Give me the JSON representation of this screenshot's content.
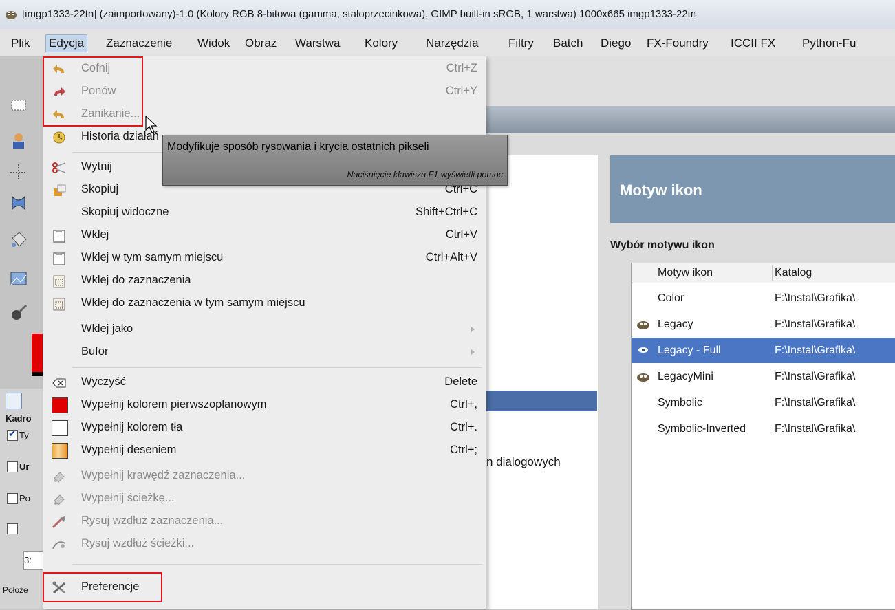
{
  "window": {
    "title": "[imgp1333-22tn] (zaimportowany)-1.0 (Kolory RGB 8-bitowa (gamma, stałoprzecinkowa), GIMP built-in sRGB, 1 warstwa) 1000x665 imgp1333-22tn"
  },
  "menubar": {
    "items": [
      "Plik",
      "Edycja",
      "Zaznaczenie",
      "Widok",
      "Obraz",
      "Warstwa",
      "Kolory",
      "Narzędzia",
      "Filtry",
      "Batch",
      "Diego",
      "FX-Foundry",
      "ICCII FX",
      "Python-Fu"
    ],
    "active": "Edycja"
  },
  "edit_menu": {
    "items": [
      {
        "label": "Cofnij",
        "shortcut": "Ctrl+Z",
        "icon": "undo-icon",
        "disabled": true
      },
      {
        "label": "Ponów",
        "shortcut": "Ctrl+Y",
        "icon": "redo-icon",
        "disabled": true
      },
      {
        "label": "Zanikanie...",
        "shortcut": "",
        "icon": "fade-icon",
        "disabled": true
      },
      {
        "label": "Historia działań",
        "shortcut": "",
        "icon": "history-icon",
        "disabled": false
      },
      {
        "label": "Wytnij",
        "shortcut": "",
        "icon": "cut-icon",
        "disabled": false
      },
      {
        "label": "Skopiuj",
        "shortcut": "Ctrl+C",
        "icon": "copy-icon",
        "disabled": false
      },
      {
        "label": "Skopiuj widoczne",
        "shortcut": "Shift+Ctrl+C",
        "icon": "",
        "disabled": false
      },
      {
        "label": "Wklej",
        "shortcut": "Ctrl+V",
        "icon": "paste-icon",
        "disabled": false
      },
      {
        "label": "Wklej w tym samym miejscu",
        "shortcut": "Ctrl+Alt+V",
        "icon": "paste-in-place-icon",
        "disabled": false
      },
      {
        "label": "Wklej do zaznaczenia",
        "shortcut": "",
        "icon": "paste-into-icon",
        "disabled": false
      },
      {
        "label": "Wklej do zaznaczenia w tym samym miejscu",
        "shortcut": "",
        "icon": "paste-into-in-place-icon",
        "disabled": false
      },
      {
        "label": "Wklej jako",
        "shortcut": "",
        "icon": "",
        "disabled": false,
        "submenu": true
      },
      {
        "label": "Bufor",
        "shortcut": "",
        "icon": "",
        "disabled": false,
        "submenu": true
      },
      {
        "label": "Wyczyść",
        "shortcut": "Delete",
        "icon": "clear-icon",
        "disabled": false
      },
      {
        "label": "Wypełnij kolorem pierwszoplanowym",
        "shortcut": "Ctrl+,",
        "icon": "fg-swatch",
        "disabled": false
      },
      {
        "label": "Wypełnij kolorem tła",
        "shortcut": "Ctrl+.",
        "icon": "bg-swatch",
        "disabled": false
      },
      {
        "label": "Wypełnij deseniem",
        "shortcut": "Ctrl+;",
        "icon": "pattern-swatch",
        "disabled": false
      },
      {
        "label": "Wypełnij krawędź zaznaczenia...",
        "shortcut": "",
        "icon": "fill-selection-outline-icon",
        "disabled": true
      },
      {
        "label": "Wypełnij ścieżkę...",
        "shortcut": "",
        "icon": "fill-path-icon",
        "disabled": true
      },
      {
        "label": "Rysuj wzdłuż zaznaczenia...",
        "shortcut": "",
        "icon": "stroke-selection-icon",
        "disabled": true
      },
      {
        "label": "Rysuj wzdłuż ścieżki...",
        "shortcut": "",
        "icon": "stroke-path-icon",
        "disabled": true
      },
      {
        "label": "Preferencje",
        "shortcut": "",
        "icon": "preferences-icon",
        "disabled": false
      }
    ]
  },
  "tooltip": {
    "text": "Modyfikuje sposób rysowania i krycia ostatnich pikseli",
    "hint": "Naciśnięcie klawisza F1 wyświetli pomoc"
  },
  "preferences": {
    "left_fragment": "n dialogowych",
    "header": "Motyw ikon",
    "section": "Wybór motywu ikon",
    "columns": [
      "Motyw ikon",
      "Katalog"
    ],
    "themes": [
      {
        "name": "Color",
        "path": "F:\\Instal\\Grafika\\",
        "icon": ""
      },
      {
        "name": "Legacy",
        "path": "F:\\Instal\\Grafika\\",
        "icon": "wilber-icon"
      },
      {
        "name": "Legacy - Full",
        "path": "F:\\Instal\\Grafika\\",
        "icon": "eye-icon",
        "selected": true
      },
      {
        "name": "LegacyMini",
        "path": "F:\\Instal\\Grafika\\",
        "icon": "wilber-icon"
      },
      {
        "name": "Symbolic",
        "path": "F:\\Instal\\Grafika\\",
        "icon": ""
      },
      {
        "name": "Symbolic-Inverted",
        "path": "F:\\Instal\\Grafika\\",
        "icon": ""
      }
    ]
  },
  "tool_options": {
    "labels": [
      "Kadro",
      "Ty",
      "Ur",
      "Po",
      "3:",
      "Położe"
    ]
  },
  "colors": {
    "highlight_red": "#e0161c",
    "selection_blue": "#4b76c4",
    "header_blue": "#7d97b1"
  }
}
